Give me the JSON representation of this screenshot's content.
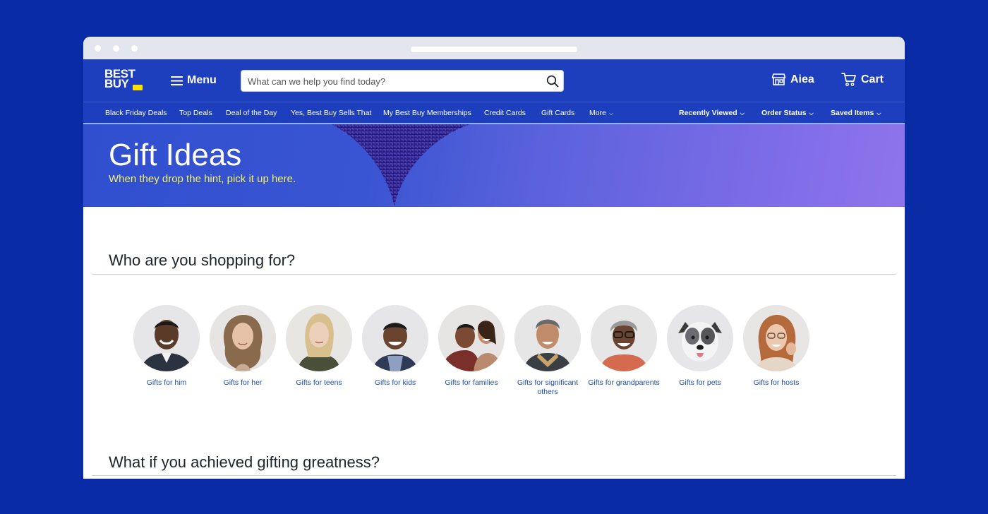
{
  "header": {
    "logo_top": "BEST",
    "logo_bottom": "BUY",
    "menu_label": "Menu",
    "search_placeholder": "What can we help you find today?",
    "store_label": "Aiea",
    "cart_label": "Cart"
  },
  "subnav": {
    "items": [
      "Black Friday Deals",
      "Top Deals",
      "Deal of the Day",
      "Yes, Best Buy Sells That",
      "My Best Buy Memberships",
      "Credit Cards",
      "Gift Cards",
      "More"
    ],
    "right": [
      "Recently Viewed",
      "Order Status",
      "Saved Items"
    ]
  },
  "hero": {
    "title": "Gift Ideas",
    "subtitle": "When they drop the hint, pick it up here."
  },
  "sections": {
    "shopping_for": "Who are you shopping for?",
    "greatness": "What if you achieved gifting greatness?"
  },
  "gifts": [
    {
      "label": "Gifts for him"
    },
    {
      "label": "Gifts for her"
    },
    {
      "label": "Gifts for teens"
    },
    {
      "label": "Gifts for kids"
    },
    {
      "label": "Gifts for families"
    },
    {
      "label": "Gifts for significant others"
    },
    {
      "label": "Gifts for grandparents"
    },
    {
      "label": "Gifts for pets"
    },
    {
      "label": "Gifts for hosts"
    }
  ],
  "colors": {
    "brand_blue": "#1d3fbe",
    "brand_yellow": "#ffe000",
    "link_blue": "#1b4fae",
    "outer_bg": "#0a2ba6"
  }
}
